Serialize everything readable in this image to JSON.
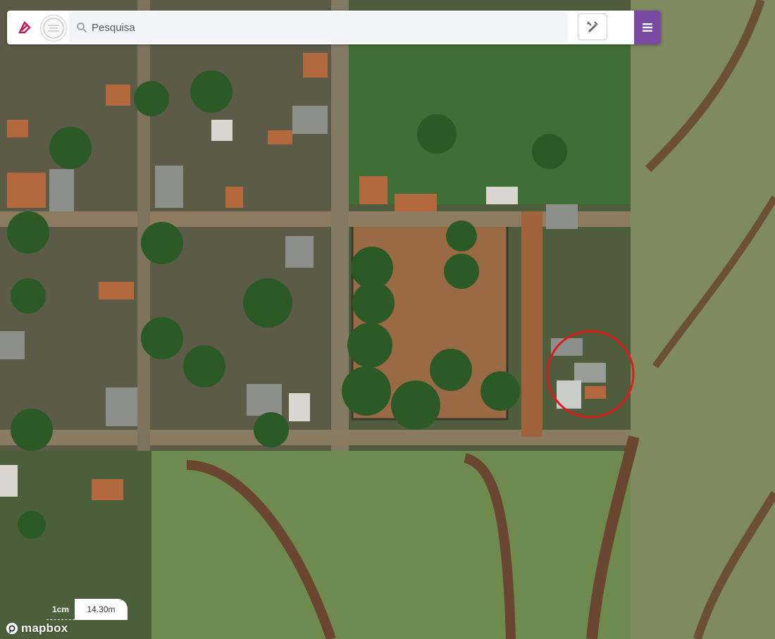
{
  "search": {
    "placeholder": "Pesquisa",
    "value": ""
  },
  "scale": {
    "unit_label": "1cm",
    "distance_label": "14.30m"
  },
  "attribution": {
    "brand": "mapbox"
  },
  "icons": {
    "brand_logo": "brand-logo-icon",
    "seal": "municipal-seal-icon",
    "search": "search-icon",
    "tools": "drawing-tools-icon",
    "menu": "hamburger-menu-icon",
    "mapbox": "mapbox-logo-icon"
  },
  "colors": {
    "menu_button": "#7a4aa2",
    "highlight_circle": "#e01b1b",
    "brand_logo": "#c2185b"
  },
  "highlight": {
    "shape": "circle"
  }
}
